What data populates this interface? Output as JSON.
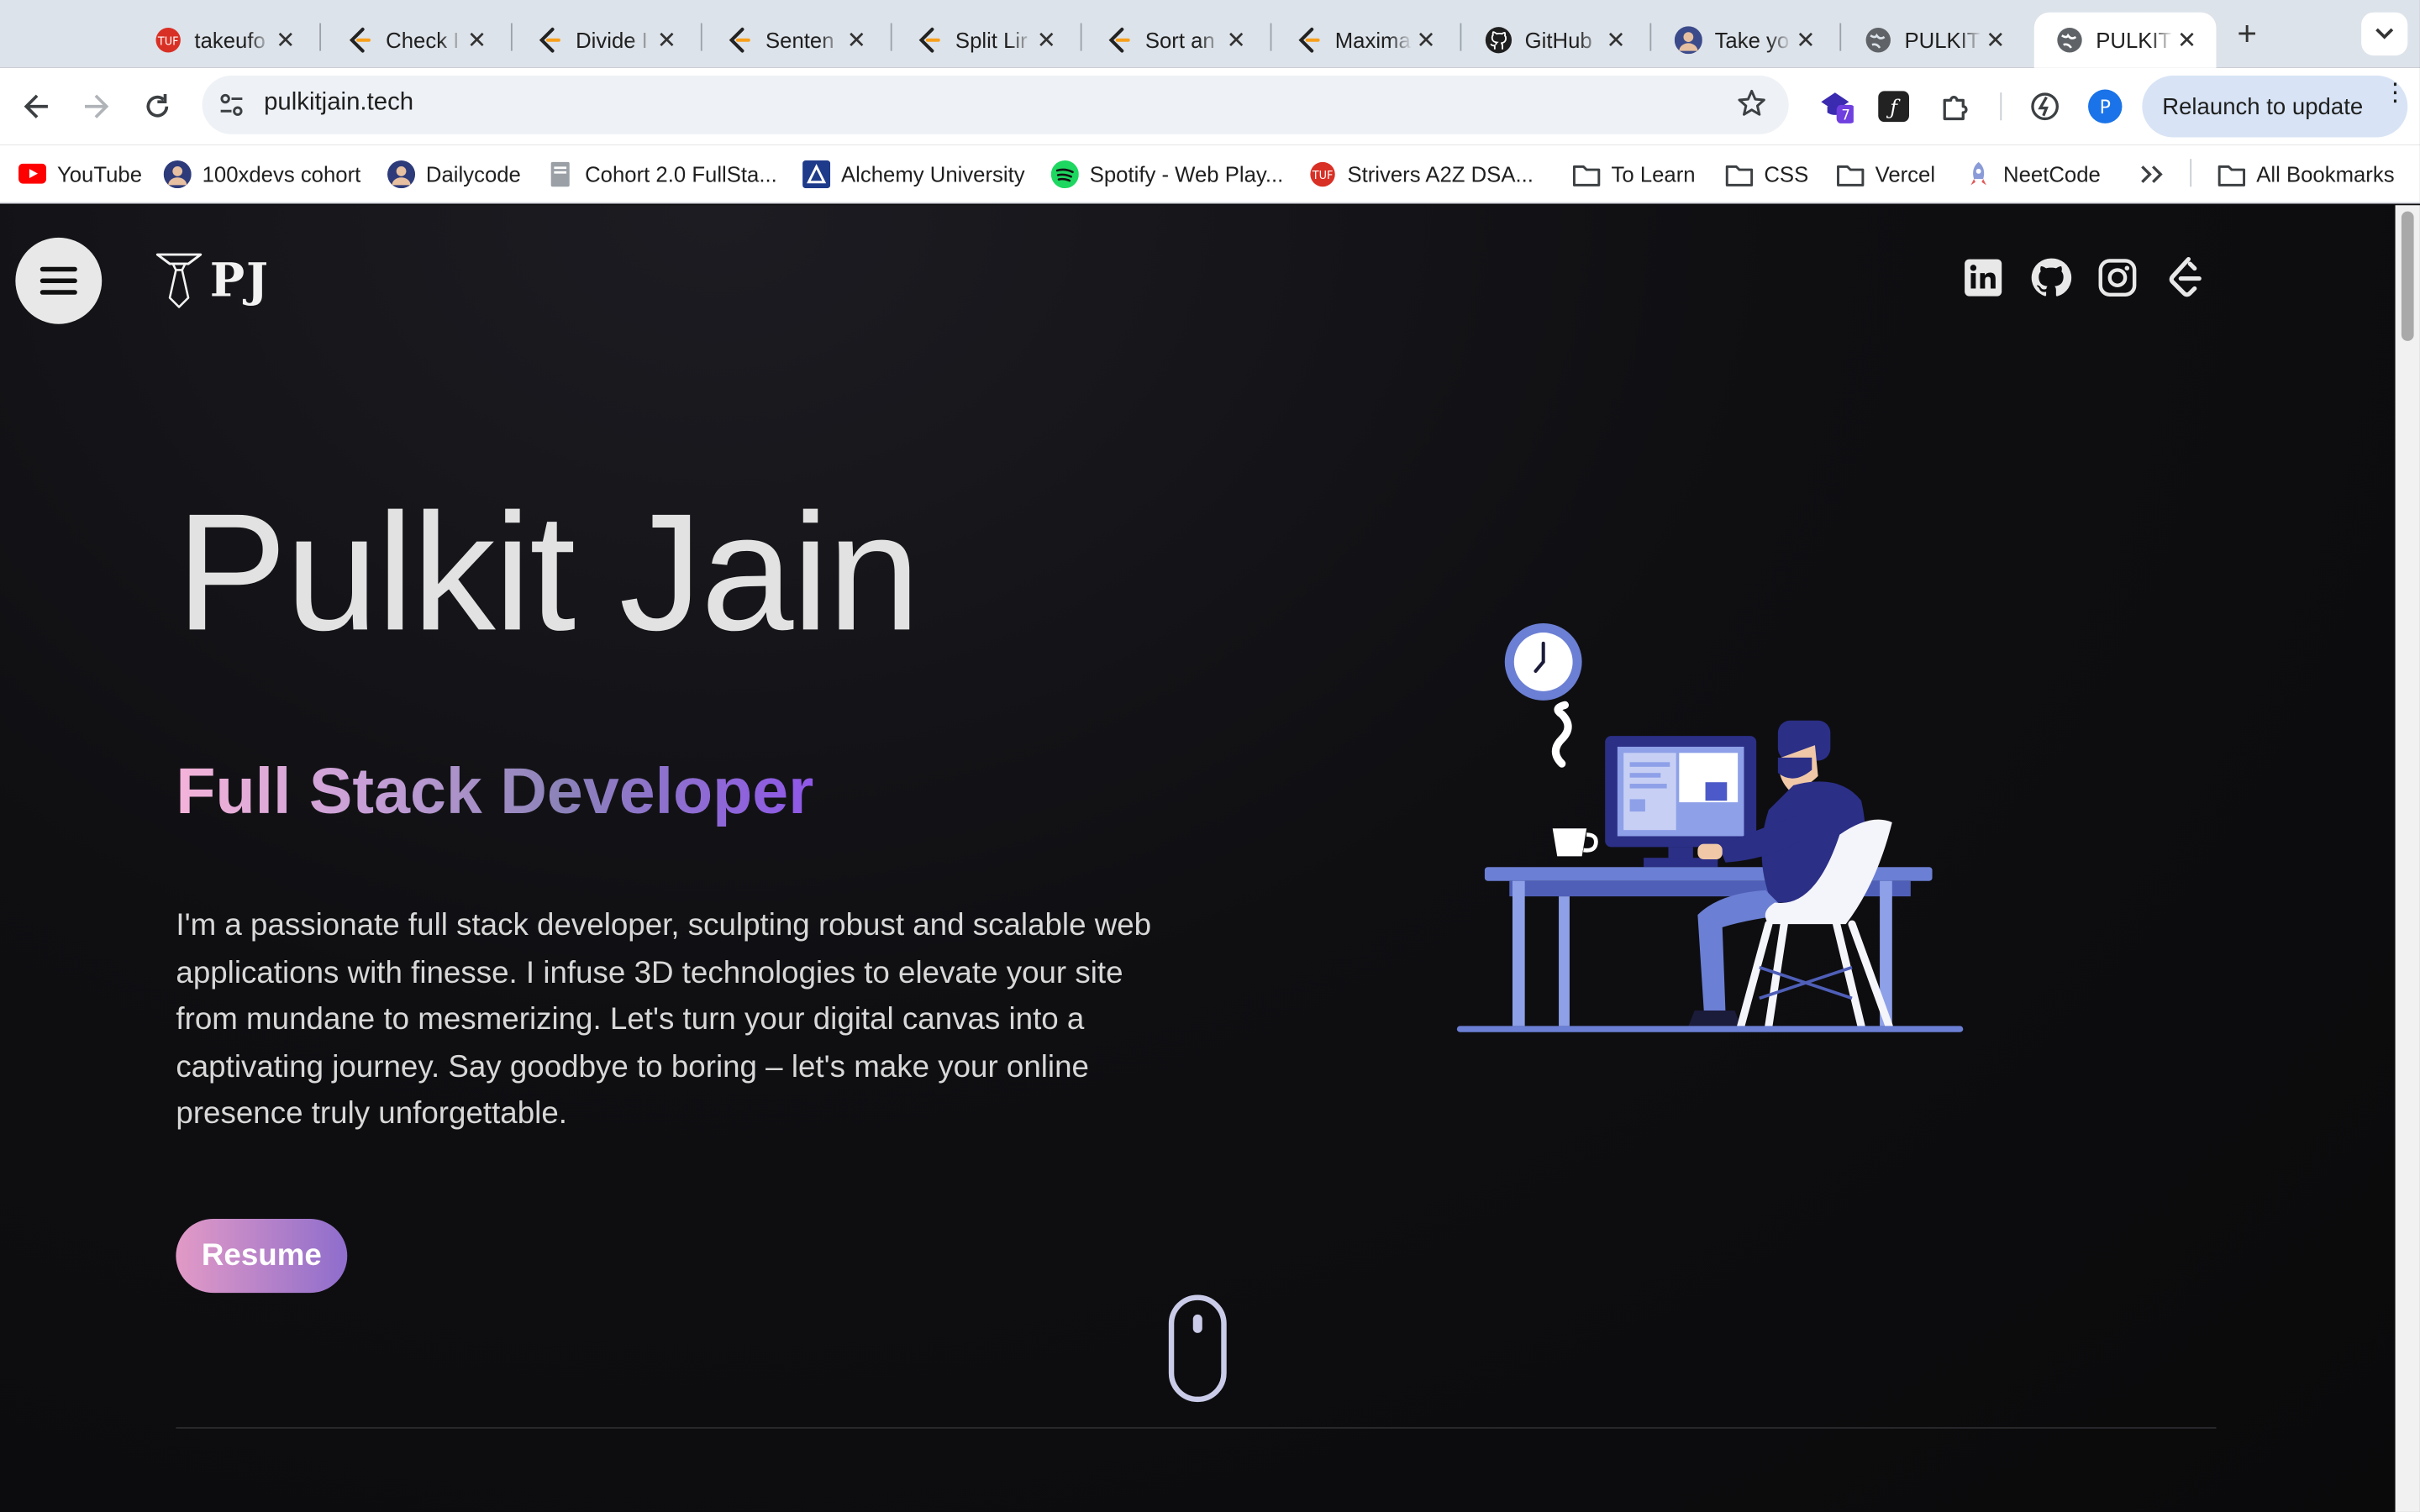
{
  "browser": {
    "tabs": [
      {
        "title": "takeufo",
        "icon": "tuf-icon",
        "active": false
      },
      {
        "title": "Check I",
        "icon": "leetcode-icon",
        "active": false
      },
      {
        "title": "Divide I",
        "icon": "leetcode-icon",
        "active": false
      },
      {
        "title": "Senten",
        "icon": "leetcode-icon",
        "active": false
      },
      {
        "title": "Split Lir",
        "icon": "leetcode-icon",
        "active": false
      },
      {
        "title": "Sort an",
        "icon": "leetcode-icon",
        "active": false
      },
      {
        "title": "Maxima",
        "icon": "leetcode-icon",
        "active": false
      },
      {
        "title": "GitHub",
        "icon": "github-icon",
        "active": false
      },
      {
        "title": "Take yo",
        "icon": "avatar-icon",
        "active": false
      },
      {
        "title": "PULKIT",
        "icon": "globe-icon",
        "active": false
      },
      {
        "title": "PULKIT",
        "icon": "globe-icon",
        "active": true
      }
    ],
    "url": "pulkitjain.tech",
    "extension_badge": "7",
    "profile_initial": "P",
    "relaunch_label": "Relaunch to update",
    "bookmarks": [
      {
        "label": "YouTube",
        "icon": "youtube-icon"
      },
      {
        "label": "100xdevs cohort",
        "icon": "avatar-icon"
      },
      {
        "label": "Dailycode",
        "icon": "avatar-icon"
      },
      {
        "label": "Cohort 2.0 FullSta...",
        "icon": "page-icon"
      },
      {
        "label": "Alchemy University",
        "icon": "alchemy-icon"
      },
      {
        "label": "Spotify - Web Play...",
        "icon": "spotify-icon"
      },
      {
        "label": "Strivers A2Z DSA...",
        "icon": "tuf-icon"
      },
      {
        "label": "To Learn",
        "icon": "folder-icon"
      },
      {
        "label": "CSS",
        "icon": "folder-icon"
      },
      {
        "label": "Vercel",
        "icon": "folder-icon"
      },
      {
        "label": "NeetCode",
        "icon": "rocket-icon"
      }
    ],
    "all_bookmarks_label": "All Bookmarks"
  },
  "site": {
    "logo_text": "PJ",
    "social_links": [
      "linkedin-icon",
      "github-icon",
      "instagram-icon",
      "leetcode-icon"
    ],
    "hero": {
      "name": "Pulkit Jain",
      "role": "Full Stack Developer",
      "bio": "I'm a passionate full stack developer, sculpting robust and scalable web applications with finesse. I infuse 3D technologies to elevate your site from mundane to mesmerizing. Let's turn your digital canvas into a captivating journey. Say goodbye to boring – let's make your online presence truly unforgettable.",
      "resume_label": "Resume"
    }
  },
  "colors": {
    "tab_strip": "#dde3ea",
    "relaunch_bg": "#d8e4f5",
    "page_bg": "#0d0d10",
    "accent_pink": "#f4b3d9",
    "accent_purple": "#8f57e8",
    "illustration_blue": "#6b7fd4",
    "illustration_navy": "#2b2f86"
  }
}
